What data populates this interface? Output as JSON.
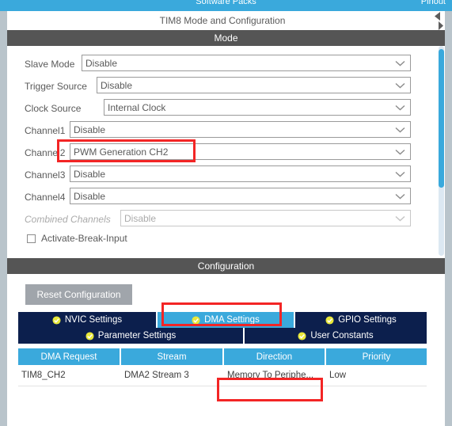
{
  "topbar": {
    "center_label": "Software Packs",
    "right_label": "Pinout"
  },
  "panel": {
    "title": "TIM8 Mode and Configuration",
    "collapse_icon": "collapse-arrows-icon"
  },
  "mode": {
    "header": "Mode",
    "fields": [
      {
        "label": "Slave Mode",
        "value": "Disable",
        "disabled": false
      },
      {
        "label": "Trigger Source",
        "value": "Disable",
        "disabled": false
      },
      {
        "label": "Clock Source",
        "value": "Internal Clock",
        "disabled": false
      },
      {
        "label": "Channel1",
        "value": "Disable",
        "disabled": false
      },
      {
        "label": "Channel2",
        "value": "PWM Generation CH2",
        "disabled": false
      },
      {
        "label": "Channel3",
        "value": "Disable",
        "disabled": false
      },
      {
        "label": "Channel4",
        "value": "Disable",
        "disabled": false
      },
      {
        "label": "Combined Channels",
        "value": "Disable",
        "disabled": true
      }
    ],
    "checkbox": {
      "label": "Activate-Break-Input",
      "checked": false
    },
    "chevron_icon": "chevron-down-icon"
  },
  "configuration": {
    "header": "Configuration",
    "reset_button": "Reset Configuration",
    "tabs_row1": [
      {
        "label": "NVIC Settings",
        "active": false,
        "icon": "check-circle-icon"
      },
      {
        "label": "DMA Settings",
        "active": true,
        "icon": "check-circle-icon"
      },
      {
        "label": "GPIO Settings",
        "active": false,
        "icon": "check-circle-icon"
      }
    ],
    "tabs_row2": [
      {
        "label": "Parameter Settings",
        "active": false,
        "icon": "check-circle-icon"
      },
      {
        "label": "User Constants",
        "active": false,
        "icon": "check-circle-icon"
      }
    ],
    "table": {
      "columns": [
        "DMA Request",
        "Stream",
        "Direction",
        "Priority"
      ],
      "rows": [
        {
          "dma_request": "TIM8_CH2",
          "stream": "DMA2 Stream 3",
          "direction": "Memory To Periphe...",
          "priority": "Low"
        }
      ]
    }
  },
  "scrollbar": {
    "name": "vertical-scrollbar"
  },
  "annotations": [
    {
      "name": "highlight-channel2-value"
    },
    {
      "name": "highlight-dma-settings-tab"
    },
    {
      "name": "highlight-direction-cell"
    }
  ],
  "colors": {
    "accent_blue": "#3aa9dc",
    "tab_navy": "#0c1f4d",
    "section_gray": "#555555",
    "annotation_red": "#f32525",
    "check_yellow": "#e8e83a",
    "gutter": "#b9c4cb"
  }
}
